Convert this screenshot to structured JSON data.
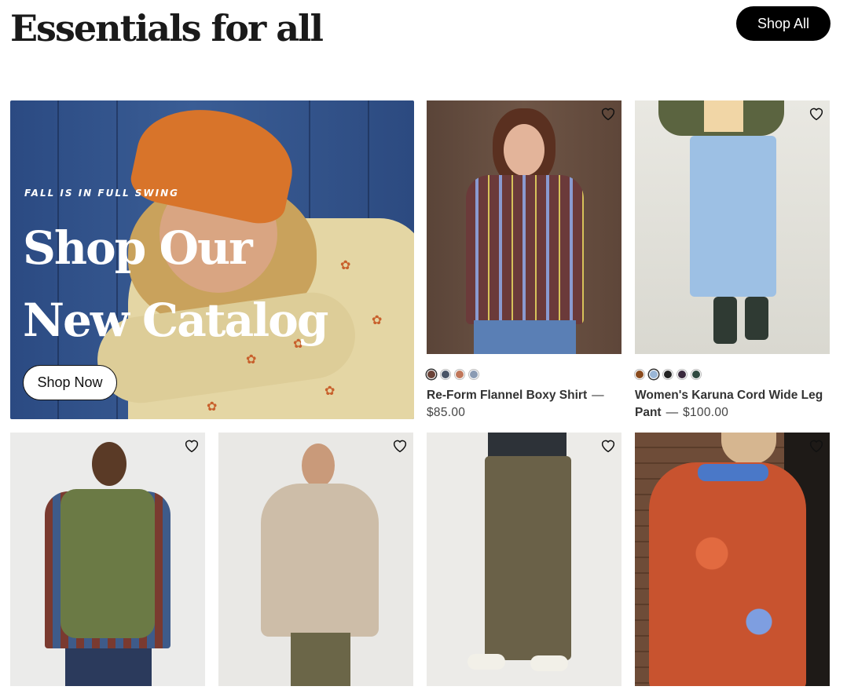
{
  "section": {
    "title": "Essentials for all",
    "shop_all_label": "Shop All"
  },
  "hero": {
    "kicker": "FALL IS IN FULL SWING",
    "title": "Shop Our New Catalog",
    "button_label": "Shop Now",
    "colors": {
      "background": "#2e4d86",
      "beanie": "#d8742a",
      "sweater": "#e4d6a4"
    }
  },
  "products": [
    {
      "name": "Re-Form Flannel Boxy Shirt",
      "price": "$85.00",
      "swatches": [
        "#6b4338",
        "#4a5566",
        "#c0775a",
        "#8a9bb3"
      ],
      "selected_swatch": 0,
      "icon": "heart-icon"
    },
    {
      "name": "Women's Karuna Cord Wide Leg Pant",
      "price": "$100.00",
      "swatches": [
        "#8a4b1e",
        "#9ab6d6",
        "#222222",
        "#3a2a3e",
        "#2f4a40"
      ],
      "selected_swatch": 1,
      "icon": "heart-icon"
    },
    {
      "name": "",
      "price": "",
      "icon": "heart-icon"
    },
    {
      "name": "",
      "price": "",
      "icon": "heart-icon"
    },
    {
      "name": "",
      "price": "",
      "icon": "heart-icon"
    },
    {
      "name": "",
      "price": "",
      "icon": "heart-icon"
    }
  ],
  "separator": "—"
}
